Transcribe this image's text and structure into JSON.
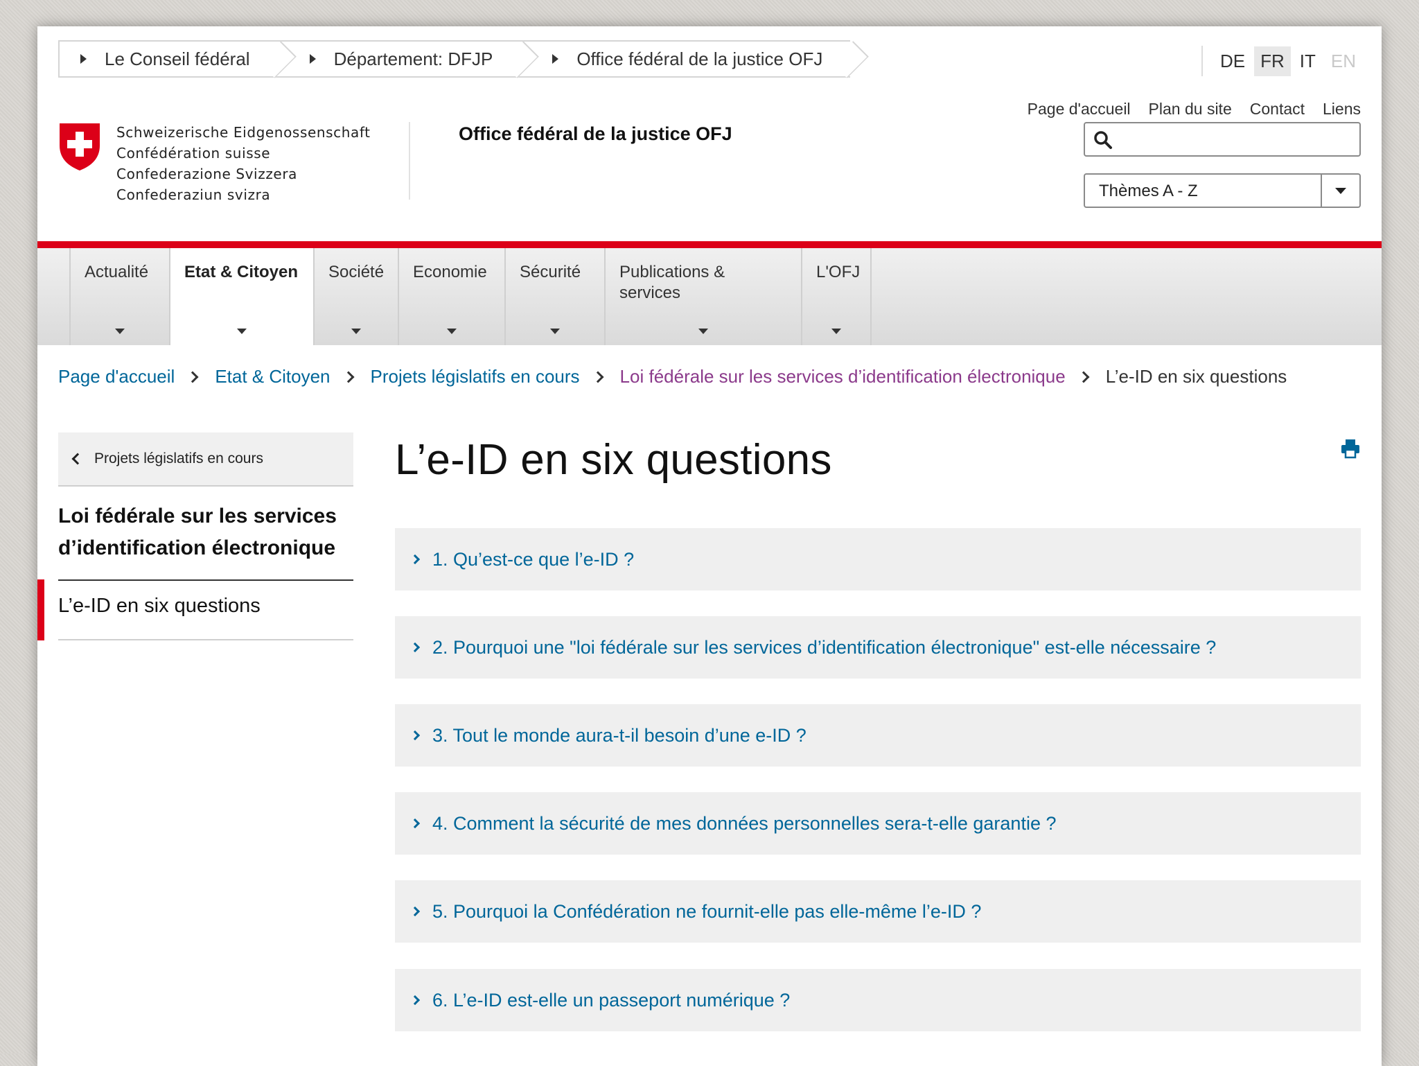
{
  "topbar": {
    "crumbs": [
      "Le Conseil fédéral",
      "Département: DFJP",
      "Office fédéral de la justice OFJ"
    ],
    "languages": [
      {
        "code": "DE",
        "state": "normal"
      },
      {
        "code": "FR",
        "state": "active"
      },
      {
        "code": "IT",
        "state": "normal"
      },
      {
        "code": "EN",
        "state": "disabled"
      }
    ]
  },
  "header": {
    "confederation": [
      "Schweizerische Eidgenossenschaft",
      "Confédération suisse",
      "Confederazione Svizzera",
      "Confederaziun svizra"
    ],
    "office": "Office fédéral de la justice OFJ",
    "service_links": [
      "Page d'accueil",
      "Plan du site",
      "Contact",
      "Liens"
    ],
    "search": {
      "value": "",
      "placeholder": ""
    },
    "themes": {
      "selected": "Thèmes A - Z"
    }
  },
  "nav": {
    "items": [
      {
        "label": "Actualité",
        "active": false
      },
      {
        "label": "Etat & Citoyen",
        "active": true
      },
      {
        "label": "Société",
        "active": false
      },
      {
        "label": "Economie",
        "active": false
      },
      {
        "label": "Sécurité",
        "active": false
      },
      {
        "label": "Publications & services",
        "active": false
      },
      {
        "label": "L'OFJ",
        "active": false
      }
    ]
  },
  "breadcrumb": {
    "items": [
      {
        "label": "Page d'accueil",
        "state": "link"
      },
      {
        "label": "Etat & Citoyen",
        "state": "link"
      },
      {
        "label": "Projets législatifs en cours",
        "state": "link"
      },
      {
        "label": "Loi fédérale sur les services d’identification électronique",
        "state": "visited"
      },
      {
        "label": "L’e-ID en six questions",
        "state": "current"
      }
    ]
  },
  "sidebar": {
    "back": "Projets législatifs en cours",
    "heading": "Loi fédérale sur les services d’identification électronique",
    "current": "L’e-ID en six questions"
  },
  "main": {
    "title": "L’e-ID en six questions",
    "faq": [
      "1. Qu’est-ce que l’e-ID ?",
      "2. Pourquoi une \"loi fédérale sur les services d’identification électronique\" est-elle nécessaire ?",
      "3. Tout le monde aura-t-il besoin d’une e-ID ?",
      "4. Comment la sécurité de mes données personnelles sera-t-elle garantie ?",
      "5. Pourquoi la Confédération ne fournit-elle pas elle-même l’e-ID ?",
      "6. L’e-ID est-elle un passeport numérique ?"
    ]
  },
  "colors": {
    "accent_red": "#dc0018",
    "link_blue": "#006699",
    "visited_purple": "#8b3a8b"
  },
  "icons": [
    "swiss-shield-icon",
    "search-icon",
    "chevron-down-icon",
    "print-icon",
    "chevron-right-icon",
    "chevron-left-icon"
  ]
}
